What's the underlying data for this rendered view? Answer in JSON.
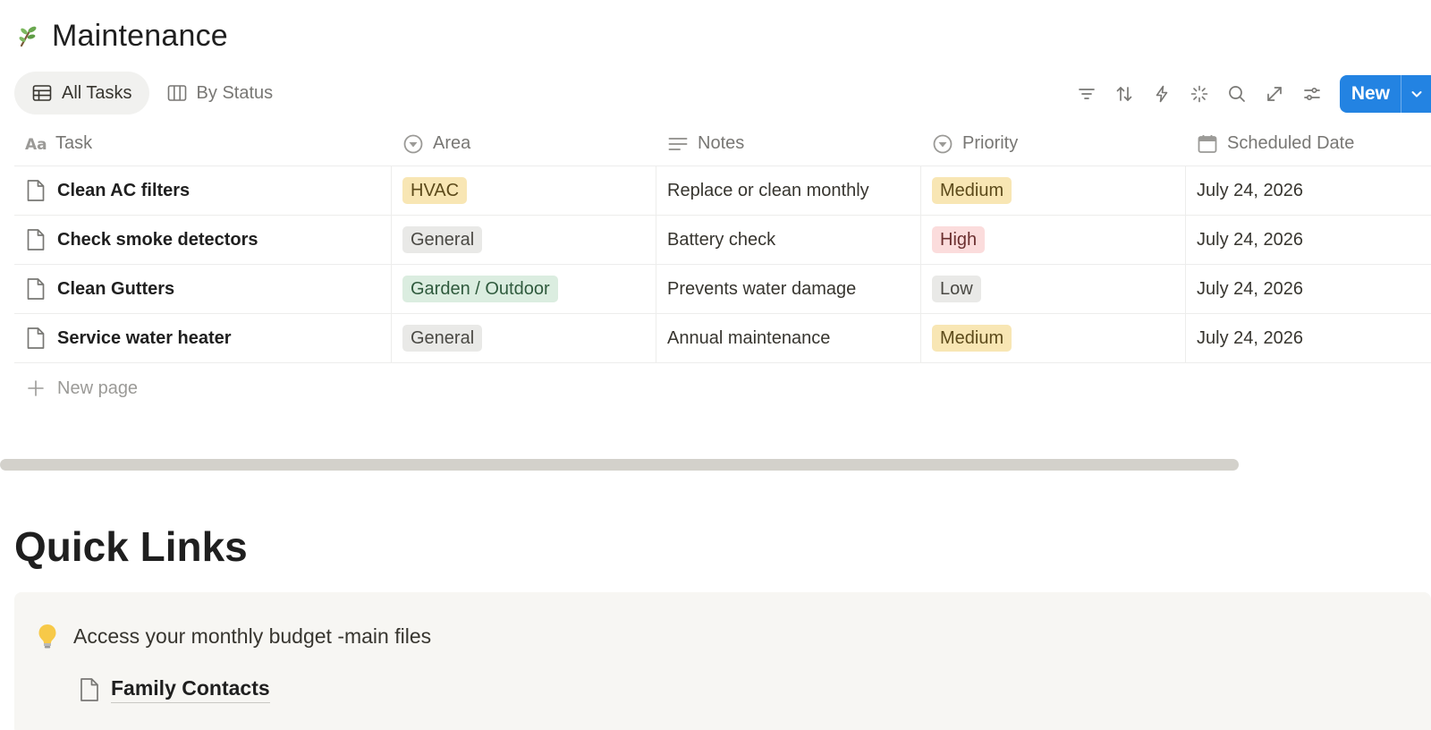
{
  "page": {
    "title": "Maintenance",
    "icon": "leaf-branch-icon"
  },
  "views": [
    {
      "label": "All Tasks",
      "icon": "table-icon",
      "active": true
    },
    {
      "label": "By Status",
      "icon": "board-icon",
      "active": false
    }
  ],
  "toolbar": {
    "icons": [
      "filter-icon",
      "sort-icon",
      "automation-bolt-icon",
      "sparkle-ai-icon",
      "search-icon",
      "expand-icon",
      "settings-sliders-icon"
    ],
    "new_label": "New"
  },
  "table": {
    "columns": [
      {
        "label": "Task",
        "icon": "text-aa-icon"
      },
      {
        "label": "Area",
        "icon": "select-circle-icon"
      },
      {
        "label": "Notes",
        "icon": "text-lines-icon"
      },
      {
        "label": "Priority",
        "icon": "select-circle-icon"
      },
      {
        "label": "Scheduled Date",
        "icon": "calendar-icon"
      }
    ],
    "rows": [
      {
        "task": "Clean AC filters",
        "area": "HVAC",
        "notes": "Replace or clean monthly",
        "priority": "Medium",
        "date": "July 24, 2026"
      },
      {
        "task": "Check smoke detectors",
        "area": "General",
        "notes": "Battery check",
        "priority": "High",
        "date": "July 24, 2026"
      },
      {
        "task": "Clean Gutters",
        "area": "Garden / Outdoor",
        "notes": "Prevents water damage",
        "priority": "Low",
        "date": "July 24, 2026"
      },
      {
        "task": "Service water heater",
        "area": "General",
        "notes": "Annual maintenance",
        "priority": "Medium",
        "date": "July 24, 2026"
      }
    ],
    "new_page_label": "New page"
  },
  "tag_colors": {
    "HVAC": {
      "bg": "#f8e6b4",
      "fg": "#5c4a1a"
    },
    "General": {
      "bg": "#e9e9e7",
      "fg": "#4a4944"
    },
    "Garden / Outdoor": {
      "bg": "#dbede0",
      "fg": "#2f5a3d"
    },
    "Medium": {
      "bg": "#f8e6b4",
      "fg": "#5c4a1a"
    },
    "High": {
      "bg": "#fbdcdc",
      "fg": "#6b2f2f"
    },
    "Low": {
      "bg": "#e9e9e7",
      "fg": "#4a4944"
    }
  },
  "quick_links": {
    "heading": "Quick Links",
    "callout_icon": "lightbulb-icon",
    "callout_text": "Access your monthly budget -main files",
    "link_label": "Family Contacts"
  }
}
